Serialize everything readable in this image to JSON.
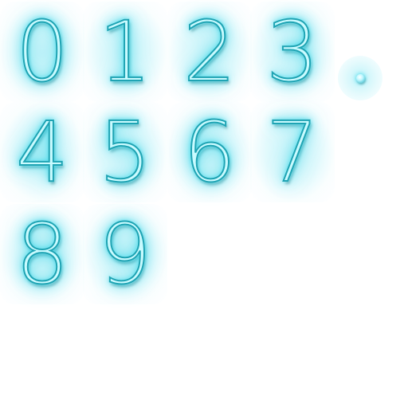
{
  "sprite_sheet": {
    "glow_color": "#37d4e6",
    "tube_color": "#c9fbff",
    "outline_color": "#1fa4b4",
    "glyphs": {
      "g0": "0",
      "g1": "1",
      "g2": "2",
      "g3": "3",
      "g4": "4",
      "g5": "5",
      "g6": "6",
      "g7": "7",
      "g8": "8",
      "g9": "9"
    }
  }
}
